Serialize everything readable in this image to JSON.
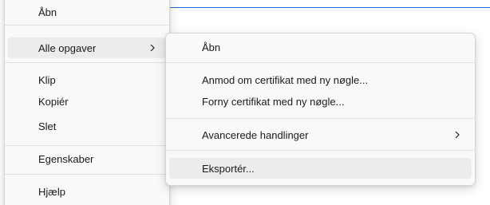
{
  "main_menu": {
    "open_label": "Åbn",
    "all_tasks_label": "Alle opgaver",
    "cut_label": "Klip",
    "copy_label": "Kopiér",
    "delete_label": "Slet",
    "properties_label": "Egenskaber",
    "help_label": "Hjælp"
  },
  "submenu": {
    "open_label": "Åbn",
    "request_new_key_label": "Anmod om certifikat med ny nøgle...",
    "renew_new_key_label": "Forny certifikat med ny nøgle...",
    "advanced_label": "Avancerede handlinger",
    "export_label": "Eksportér..."
  },
  "colors": {
    "accent_line": "#1e6fd9",
    "hover_background": "#ececec",
    "menu_background": "#f9f9f9"
  },
  "icons": {
    "submenu_arrow": "chevron-right-icon"
  }
}
